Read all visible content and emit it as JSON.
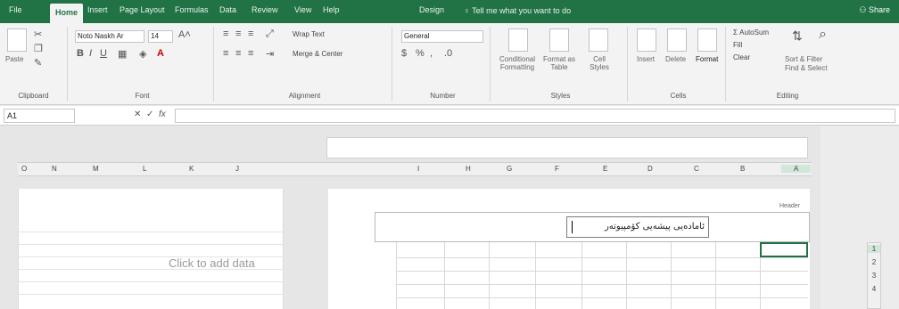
{
  "tabs": [
    {
      "label": "File",
      "active": false
    },
    {
      "label": "Home",
      "active": true
    },
    {
      "label": "Insert",
      "active": false
    },
    {
      "label": "Page Layout",
      "active": false
    },
    {
      "label": "Formulas",
      "active": false
    },
    {
      "label": "Data",
      "active": false
    },
    {
      "label": "Review",
      "active": false
    },
    {
      "label": "View",
      "active": false
    },
    {
      "label": "Help",
      "active": false
    },
    {
      "label": "Design",
      "active": false
    }
  ],
  "tellme": "Tell me what you want to do",
  "signin": "Share",
  "ribbon": {
    "clipboard": {
      "label": "Clipboard",
      "paste": "Paste"
    },
    "font": {
      "label": "Font",
      "family": "Noto Naskh Ar",
      "size": "14"
    },
    "alignment": {
      "label": "Alignment",
      "wrap": "Wrap Text",
      "merge": "Merge & Center"
    },
    "number": {
      "label": "Number",
      "format": "General"
    },
    "styles": {
      "label": "Styles",
      "cond": "Conditional Formatting",
      "table": "Format as Table",
      "cell": "Cell Styles"
    },
    "cells": {
      "label": "Cells",
      "insert": "Insert",
      "delete": "Delete",
      "format": "Format"
    },
    "editing": {
      "label": "Editing",
      "autosum": "AutoSum",
      "fill": "Fill",
      "clear": "Clear",
      "sort": "Sort & Filter",
      "find": "Find & Select"
    }
  },
  "formula": {
    "namebox": "A1",
    "fx": "fx"
  },
  "columns_left": [
    "O",
    "N",
    "M",
    "L",
    "K",
    "J"
  ],
  "columns_right": [
    "I",
    "H",
    "G",
    "F",
    "E",
    "D",
    "C",
    "B",
    "A"
  ],
  "placeholder": "Click to add data",
  "header_label": "Header",
  "header_text": "ئامادەیی پیشەیی کۆمپیوتەر",
  "rows": [
    "1",
    "2",
    "3",
    "4"
  ],
  "colors": {
    "accent": "#217346"
  }
}
